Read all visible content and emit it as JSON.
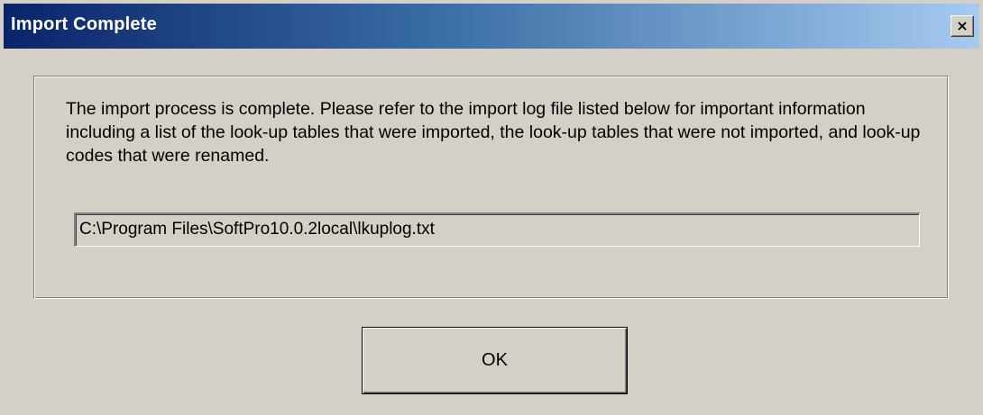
{
  "window": {
    "title": "Import Complete",
    "close_glyph": "×",
    "close_icon": "close-icon"
  },
  "content": {
    "message": "The import process is complete.  Please refer to the import log file listed below for important information including a list of the look-up tables that were imported, the look-up tables that were not imported, and look-up codes that were renamed.",
    "log_path": "C:\\Program Files\\SoftPro10.0.2local\\lkuplog.txt"
  },
  "buttons": {
    "ok_label": "OK"
  },
  "colors": {
    "titlebar_start": "#0a246a",
    "titlebar_end": "#a6caf0",
    "face": "#d4d0c8"
  }
}
